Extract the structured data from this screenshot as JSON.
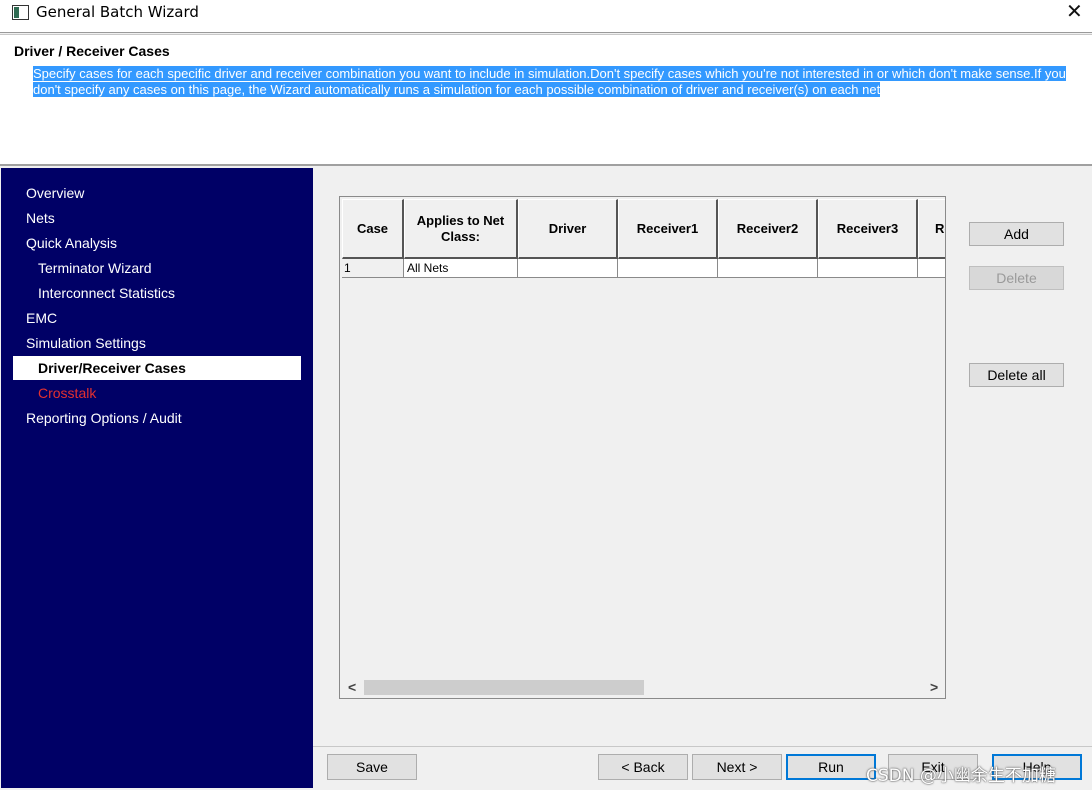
{
  "window": {
    "title": "General Batch Wizard"
  },
  "header": {
    "title": "Driver / Receiver Cases",
    "description": "Specify cases for each specific driver and receiver combination you want to include in simulation.Don't specify cases which you're not interested in or which don't make sense.If you don't specify any cases on this page, the Wizard automatically runs a simulation for each possible combination of driver and receiver(s) on each net"
  },
  "sidebar": {
    "items": [
      {
        "label": "Overview"
      },
      {
        "label": "Nets"
      },
      {
        "label": "Quick Analysis"
      },
      {
        "label": "Terminator Wizard"
      },
      {
        "label": "Interconnect Statistics"
      },
      {
        "label": "EMC"
      },
      {
        "label": "Simulation Settings"
      },
      {
        "label": "Driver/Receiver Cases"
      },
      {
        "label": "Crosstalk"
      },
      {
        "label": "Reporting Options / Audit"
      }
    ]
  },
  "grid": {
    "columns": [
      "Case",
      "Applies to Net Class:",
      "Driver",
      "Receiver1",
      "Receiver2",
      "Receiver3",
      "Re"
    ],
    "rows": [
      [
        "1",
        "All Nets",
        "",
        "",
        "",
        "",
        ""
      ]
    ]
  },
  "side_buttons": {
    "add": "Add",
    "delete": "Delete",
    "delete_all": "Delete all"
  },
  "footer": {
    "save": "Save",
    "back": "< Back",
    "next": "Next >",
    "run": "Run",
    "exit": "Exit",
    "help": "Help"
  },
  "watermark": "CSDN @小幽余生不加糖",
  "colors": {
    "sidebar_bg": "#000066",
    "selection": "#3399ff",
    "crosstalk_item": "#e23030"
  }
}
